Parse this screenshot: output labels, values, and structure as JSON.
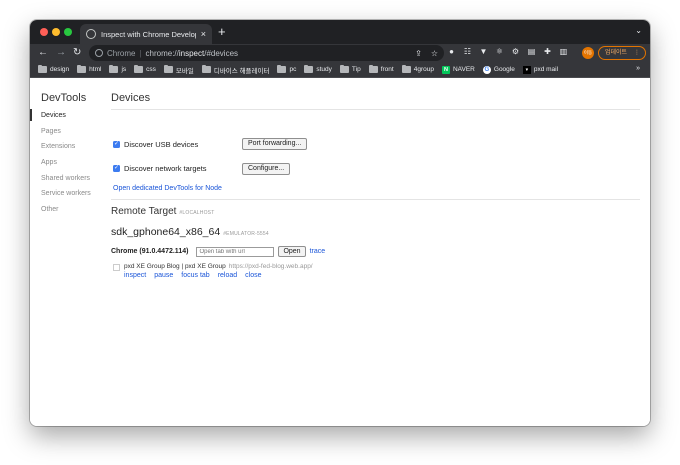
{
  "window": {
    "tab_title": "Inspect with Chrome Developer Tools",
    "new_tab_symbol": "+",
    "tab_close_symbol": "×",
    "tab_search_symbol": "⌄"
  },
  "toolbar": {
    "omnibox_site": "Chrome",
    "omnibox_url_prefix": "chrome://",
    "omnibox_url_host": "inspect",
    "omnibox_url_suffix": "/#devices",
    "profile_initial": "이동",
    "update_label": "업데이트",
    "update_menu": "⋮"
  },
  "bookmarks": {
    "items": [
      {
        "label": "design"
      },
      {
        "label": "html"
      },
      {
        "label": "js"
      },
      {
        "label": "css"
      },
      {
        "label": "모바일"
      },
      {
        "label": "디바이스 해플레이터"
      },
      {
        "label": "pc"
      },
      {
        "label": "study"
      },
      {
        "label": "Tip"
      },
      {
        "label": "front"
      },
      {
        "label": "4group"
      }
    ],
    "naver": {
      "label": "NAVER",
      "icon_text": "N"
    },
    "google": {
      "label": "Google",
      "icon_text": "G"
    },
    "pxd": {
      "label": "pxd mail",
      "icon_text": "▾"
    },
    "more": "»"
  },
  "sidebar": {
    "title": "DevTools",
    "items": [
      {
        "label": "Devices",
        "active": true
      },
      {
        "label": "Pages"
      },
      {
        "label": "Extensions"
      },
      {
        "label": "Apps"
      },
      {
        "label": "Shared workers"
      },
      {
        "label": "Service workers"
      },
      {
        "label": "Other"
      }
    ]
  },
  "main": {
    "title": "Devices",
    "discover_usb": {
      "label": "Discover USB devices",
      "checked": true,
      "button": "Port forwarding..."
    },
    "discover_network": {
      "label": "Discover network targets",
      "checked": true,
      "button": "Configure..."
    },
    "node_link": "Open dedicated DevTools for Node",
    "remote_target": {
      "title": "Remote Target",
      "tag": "#LOCALHOST"
    },
    "device": {
      "name": "sdk_gphone64_x86_64",
      "tag": "#EMULATOR-5554"
    },
    "browser": {
      "name": "Chrome (91.0.4472.114)",
      "url_placeholder": "Open tab with url",
      "open_label": "Open",
      "trace_label": "trace"
    },
    "target": {
      "title": "pxd XE Group Blog | pxd XE Group",
      "url": "https://pxd-fed-blog.web.app/",
      "actions": [
        "inspect",
        "pause",
        "focus tab",
        "reload",
        "close"
      ]
    }
  },
  "colors": {
    "tabbar": "#202124",
    "toolbar": "#35363a",
    "accent_link": "#1a55d8",
    "checkbox": "#3d7cf0",
    "update_accent": "#e37400"
  }
}
